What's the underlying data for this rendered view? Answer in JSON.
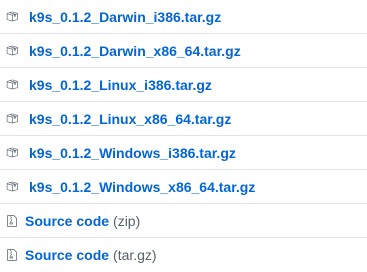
{
  "assets": [
    {
      "name": "k9s_0.1.2_Darwin_i386.tar.gz",
      "icon": "package-icon"
    },
    {
      "name": "k9s_0.1.2_Darwin_x86_64.tar.gz",
      "icon": "package-icon"
    },
    {
      "name": "k9s_0.1.2_Linux_i386.tar.gz",
      "icon": "package-icon"
    },
    {
      "name": "k9s_0.1.2_Linux_x86_64.tar.gz",
      "icon": "package-icon"
    },
    {
      "name": "k9s_0.1.2_Windows_i386.tar.gz",
      "icon": "package-icon"
    },
    {
      "name": "k9s_0.1.2_Windows_x86_64.tar.gz",
      "icon": "package-icon"
    }
  ],
  "source": [
    {
      "label": "Source code",
      "ext": "(zip)",
      "icon": "file-zip-icon"
    },
    {
      "label": "Source code",
      "ext": "(tar.gz)",
      "icon": "file-zip-icon"
    }
  ],
  "colors": {
    "link": "#0366d6",
    "muted": "#586069",
    "icon": "#6a737d",
    "divider": "#e1e4e8"
  }
}
